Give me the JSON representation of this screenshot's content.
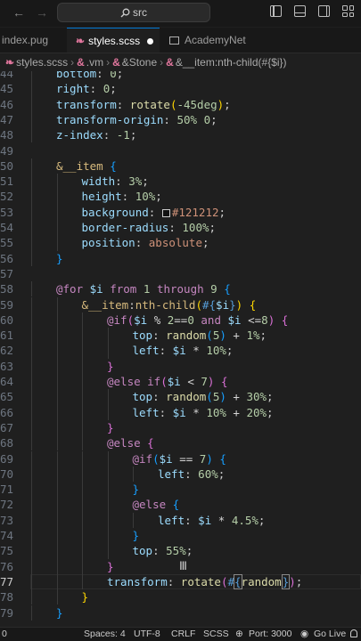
{
  "titlebar": {
    "search_text": "src",
    "back_icon": "arrow-left-icon",
    "forward_icon": "arrow-right-icon"
  },
  "tabs": [
    {
      "label": "index.pug",
      "active": false
    },
    {
      "label": "styles.scss",
      "active": true,
      "modified": true
    },
    {
      "label": "AcademyNet",
      "active": false
    }
  ],
  "breadcrumb": [
    "styles.scss",
    ".vm",
    "&Stone",
    "&__item:nth-child(#{$i})"
  ],
  "editor": {
    "active_line": 77,
    "lines": [
      {
        "n": "44",
        "indent": 2,
        "tokens": [
          [
            "prop",
            "bottom"
          ],
          [
            "pl",
            ": "
          ],
          [
            "num",
            "0"
          ],
          [
            "pl",
            ";"
          ]
        ]
      },
      {
        "n": "45",
        "indent": 2,
        "tokens": [
          [
            "prop",
            "right"
          ],
          [
            "pl",
            ": "
          ],
          [
            "num",
            "0"
          ],
          [
            "pl",
            ";"
          ]
        ]
      },
      {
        "n": "46",
        "indent": 2,
        "tokens": [
          [
            "prop",
            "transform"
          ],
          [
            "pl",
            ": "
          ],
          [
            "fn",
            "rotate"
          ],
          [
            "br1",
            "("
          ],
          [
            "num",
            "-45deg"
          ],
          [
            "br1",
            ")"
          ],
          [
            "pl",
            ";"
          ]
        ]
      },
      {
        "n": "47",
        "indent": 2,
        "tokens": [
          [
            "prop",
            "transform-origin"
          ],
          [
            "pl",
            ": "
          ],
          [
            "num",
            "50%"
          ],
          [
            "pl",
            " "
          ],
          [
            "num",
            "0"
          ],
          [
            "pl",
            ";"
          ]
        ]
      },
      {
        "n": "48",
        "indent": 2,
        "tokens": [
          [
            "prop",
            "z-index"
          ],
          [
            "pl",
            ": "
          ],
          [
            "num",
            "-1"
          ],
          [
            "pl",
            ";"
          ]
        ]
      },
      {
        "n": "49",
        "indent": 0,
        "tokens": []
      },
      {
        "n": "50",
        "indent": 2,
        "tokens": [
          [
            "sel",
            "&__item"
          ],
          [
            "pl",
            " "
          ],
          [
            "br3",
            "{"
          ]
        ]
      },
      {
        "n": "51",
        "indent": 3,
        "tokens": [
          [
            "prop",
            "width"
          ],
          [
            "pl",
            ": "
          ],
          [
            "num",
            "3%"
          ],
          [
            "pl",
            ";"
          ]
        ]
      },
      {
        "n": "52",
        "indent": 3,
        "tokens": [
          [
            "prop",
            "height"
          ],
          [
            "pl",
            ": "
          ],
          [
            "num",
            "10%"
          ],
          [
            "pl",
            ";"
          ]
        ]
      },
      {
        "n": "53",
        "indent": 3,
        "tokens": [
          [
            "prop",
            "background"
          ],
          [
            "pl",
            ": "
          ],
          [
            "swatch",
            ""
          ],
          [
            "str",
            "#121212"
          ],
          [
            "pl",
            ";"
          ]
        ]
      },
      {
        "n": "54",
        "indent": 3,
        "tokens": [
          [
            "prop",
            "border-radius"
          ],
          [
            "pl",
            ": "
          ],
          [
            "num",
            "100%"
          ],
          [
            "pl",
            ";"
          ]
        ]
      },
      {
        "n": "55",
        "indent": 3,
        "tokens": [
          [
            "prop",
            "position"
          ],
          [
            "pl",
            ": "
          ],
          [
            "str",
            "absolute"
          ],
          [
            "pl",
            ";"
          ]
        ]
      },
      {
        "n": "56",
        "indent": 2,
        "tokens": [
          [
            "br3",
            "}"
          ]
        ]
      },
      {
        "n": "57",
        "indent": 0,
        "tokens": []
      },
      {
        "n": "58",
        "indent": 2,
        "tokens": [
          [
            "kw",
            "@for"
          ],
          [
            "pl",
            " "
          ],
          [
            "var",
            "$i"
          ],
          [
            "pl",
            " "
          ],
          [
            "kw",
            "from"
          ],
          [
            "pl",
            " "
          ],
          [
            "num",
            "1"
          ],
          [
            "pl",
            " "
          ],
          [
            "kw",
            "through"
          ],
          [
            "pl",
            " "
          ],
          [
            "num",
            "9"
          ],
          [
            "pl",
            " "
          ],
          [
            "br3",
            "{"
          ]
        ]
      },
      {
        "n": "59",
        "indent": 3,
        "tokens": [
          [
            "sel",
            "&__item"
          ],
          [
            "pl",
            ":"
          ],
          [
            "sel",
            "nth-child"
          ],
          [
            "br1",
            "("
          ],
          [
            "interp",
            "#{"
          ],
          [
            "var",
            "$i"
          ],
          [
            "interp",
            "}"
          ],
          [
            "br1",
            ")"
          ],
          [
            "pl",
            " "
          ],
          [
            "br1",
            "{"
          ]
        ]
      },
      {
        "n": "60",
        "indent": 4,
        "tokens": [
          [
            "kw",
            "@if"
          ],
          [
            "br2",
            "("
          ],
          [
            "var",
            "$i"
          ],
          [
            "op",
            " % "
          ],
          [
            "num",
            "2"
          ],
          [
            "op",
            "=="
          ],
          [
            "num",
            "0"
          ],
          [
            "pl",
            " "
          ],
          [
            "kw",
            "and"
          ],
          [
            "pl",
            " "
          ],
          [
            "var",
            "$i"
          ],
          [
            "op",
            " <="
          ],
          [
            "num",
            "8"
          ],
          [
            "br2",
            ")"
          ],
          [
            "pl",
            " "
          ],
          [
            "br2",
            "{"
          ]
        ]
      },
      {
        "n": "61",
        "indent": 5,
        "tokens": [
          [
            "prop",
            "top"
          ],
          [
            "pl",
            ": "
          ],
          [
            "fn",
            "random"
          ],
          [
            "br3",
            "("
          ],
          [
            "num",
            "5"
          ],
          [
            "br3",
            ")"
          ],
          [
            "op",
            " + "
          ],
          [
            "num",
            "1%"
          ],
          [
            "pl",
            ";"
          ]
        ]
      },
      {
        "n": "62",
        "indent": 5,
        "tokens": [
          [
            "prop",
            "left"
          ],
          [
            "pl",
            ": "
          ],
          [
            "var",
            "$i"
          ],
          [
            "op",
            " * "
          ],
          [
            "num",
            "10%"
          ],
          [
            "pl",
            ";"
          ]
        ]
      },
      {
        "n": "63",
        "indent": 4,
        "tokens": [
          [
            "br2",
            "}"
          ]
        ]
      },
      {
        "n": "64",
        "indent": 4,
        "tokens": [
          [
            "kw",
            "@else if"
          ],
          [
            "br2",
            "("
          ],
          [
            "var",
            "$i"
          ],
          [
            "op",
            " < "
          ],
          [
            "num",
            "7"
          ],
          [
            "br2",
            ")"
          ],
          [
            "pl",
            " "
          ],
          [
            "br2",
            "{"
          ]
        ]
      },
      {
        "n": "65",
        "indent": 5,
        "tokens": [
          [
            "prop",
            "top"
          ],
          [
            "pl",
            ": "
          ],
          [
            "fn",
            "random"
          ],
          [
            "br3",
            "("
          ],
          [
            "num",
            "5"
          ],
          [
            "br3",
            ")"
          ],
          [
            "op",
            " + "
          ],
          [
            "num",
            "30%"
          ],
          [
            "pl",
            ";"
          ]
        ]
      },
      {
        "n": "66",
        "indent": 5,
        "tokens": [
          [
            "prop",
            "left"
          ],
          [
            "pl",
            ": "
          ],
          [
            "var",
            "$i"
          ],
          [
            "op",
            " * "
          ],
          [
            "num",
            "10%"
          ],
          [
            "op",
            " + "
          ],
          [
            "num",
            "20%"
          ],
          [
            "pl",
            ";"
          ]
        ]
      },
      {
        "n": "67",
        "indent": 4,
        "tokens": [
          [
            "br2",
            "}"
          ]
        ]
      },
      {
        "n": "68",
        "indent": 4,
        "tokens": [
          [
            "kw",
            "@else"
          ],
          [
            "pl",
            " "
          ],
          [
            "br2",
            "{"
          ]
        ]
      },
      {
        "n": "69",
        "indent": 5,
        "tokens": [
          [
            "kw",
            "@if"
          ],
          [
            "br3",
            "("
          ],
          [
            "var",
            "$i"
          ],
          [
            "op",
            " == "
          ],
          [
            "num",
            "7"
          ],
          [
            "br3",
            ")"
          ],
          [
            "pl",
            " "
          ],
          [
            "br3",
            "{"
          ]
        ]
      },
      {
        "n": "70",
        "indent": 6,
        "tokens": [
          [
            "prop",
            "left"
          ],
          [
            "pl",
            ": "
          ],
          [
            "num",
            "60%"
          ],
          [
            "pl",
            ";"
          ]
        ]
      },
      {
        "n": "71",
        "indent": 5,
        "tokens": [
          [
            "br3",
            "}"
          ]
        ]
      },
      {
        "n": "72",
        "indent": 5,
        "tokens": [
          [
            "kw",
            "@else"
          ],
          [
            "pl",
            " "
          ],
          [
            "br3",
            "{"
          ]
        ]
      },
      {
        "n": "73",
        "indent": 6,
        "tokens": [
          [
            "prop",
            "left"
          ],
          [
            "pl",
            ": "
          ],
          [
            "var",
            "$i"
          ],
          [
            "op",
            " * "
          ],
          [
            "num",
            "4.5%"
          ],
          [
            "pl",
            ";"
          ]
        ]
      },
      {
        "n": "74",
        "indent": 5,
        "tokens": [
          [
            "br3",
            "}"
          ]
        ]
      },
      {
        "n": "75",
        "indent": 5,
        "tokens": [
          [
            "prop",
            "top"
          ],
          [
            "pl",
            ": "
          ],
          [
            "num",
            "55%"
          ],
          [
            "pl",
            ";"
          ]
        ]
      },
      {
        "n": "76",
        "indent": 4,
        "tokens": [
          [
            "br2",
            "}"
          ]
        ]
      },
      {
        "n": "77",
        "indent": 4,
        "tokens": [
          [
            "prop",
            "transform"
          ],
          [
            "pl",
            ": "
          ],
          [
            "fn",
            "rotate"
          ],
          [
            "br2",
            "("
          ],
          [
            "interp",
            "#"
          ],
          [
            "sel-open",
            "{"
          ],
          [
            "fn",
            "random"
          ],
          [
            "caret",
            ""
          ],
          [
            "sel-close",
            "}"
          ],
          [
            "br2",
            ")"
          ],
          [
            "pl",
            ";"
          ]
        ]
      },
      {
        "n": "78",
        "indent": 3,
        "tokens": [
          [
            "br1",
            "}"
          ]
        ]
      },
      {
        "n": "79",
        "indent": 2,
        "tokens": [
          [
            "br3",
            "}"
          ]
        ]
      }
    ]
  },
  "statusbar": {
    "position": "0",
    "spaces": "Spaces: 4",
    "encoding": "UTF-8",
    "eol": "CRLF",
    "language": "SCSS",
    "port": "Port: 3000",
    "golive": "Go Live"
  }
}
